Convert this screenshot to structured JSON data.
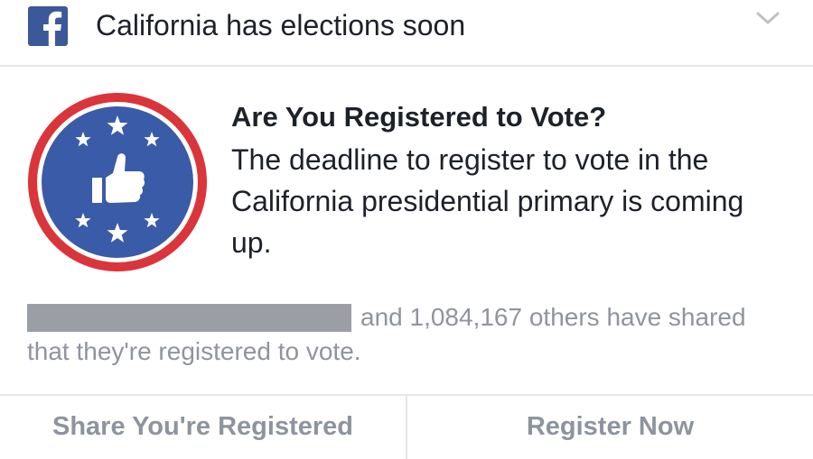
{
  "header": {
    "title": "California has elections soon",
    "logo_icon": "facebook-logo-icon",
    "menu_icon": "chevron-down-icon"
  },
  "promo": {
    "badge_icon": "vote-thumbs-up-badge-icon",
    "title": "Are You Registered to Vote?",
    "body": "The deadline to register to vote in the California presidential primary is coming up."
  },
  "social": {
    "text": "and 1,084,167 others have shared that they're registered to vote.",
    "shared_count": 1084167
  },
  "actions": {
    "share_label": "Share You're Registered",
    "register_label": "Register Now"
  },
  "colors": {
    "facebook_blue": "#3b5998",
    "badge_red": "#d9353b",
    "badge_blue": "#3a5ba7",
    "muted_text": "#90949c",
    "button_text": "#8d949e"
  }
}
